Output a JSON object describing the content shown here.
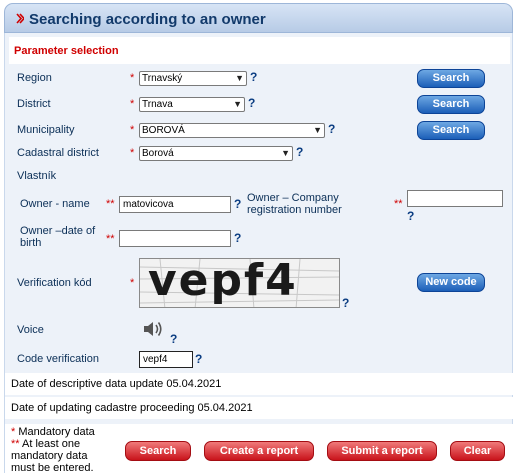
{
  "header": {
    "title": "Searching according to an owner"
  },
  "section": {
    "title": "Parameter selection"
  },
  "form": {
    "region": {
      "label": "Region",
      "marker": "*",
      "value": "Trnavský",
      "help": "?",
      "button": "Search"
    },
    "district": {
      "label": "District",
      "marker": "*",
      "value": "Trnava",
      "help": "?",
      "button": "Search"
    },
    "municipality": {
      "label": "Municipality",
      "marker": "*",
      "value": "BOROVÁ",
      "help": "?",
      "button": "Search"
    },
    "cadastral": {
      "label": "Cadastral district",
      "marker": "*",
      "value": "Borová",
      "help": "?"
    },
    "owner_heading": "Vlastník",
    "owner_name": {
      "label": "Owner - name",
      "marker": "**",
      "value": "matovicova",
      "help": "?"
    },
    "company_reg": {
      "label": "Owner – Company registration number",
      "marker": "**",
      "value": "",
      "help": "?"
    },
    "owner_birth": {
      "label": "Owner –date of birth",
      "marker": "**",
      "value": "",
      "help": "?"
    },
    "verification": {
      "label": "Verification kód",
      "marker": "*",
      "captcha_text": "vepf4",
      "help": "?",
      "new_code_button": "New code"
    },
    "voice": {
      "label": "Voice",
      "help": "?",
      "icon": "speaker-icon"
    },
    "code_verification": {
      "label": "Code verification",
      "value": "vepf4",
      "help": "?"
    }
  },
  "info": {
    "descriptive_update": "Date of descriptive data update 05.04.2021",
    "proceeding_update": "Date of updating cadastre proceeding 05.04.2021"
  },
  "footer": {
    "mandatory_marker": "*",
    "mandatory_text": "Mandatory data",
    "one_of_marker": "**",
    "one_of_text": "At least one mandatory data must be entered.",
    "buttons": {
      "search": "Search",
      "create_report": "Create a report",
      "submit_report": "Submit a report",
      "clear": "Clear"
    }
  },
  "colors": {
    "accent_blue": "#1c5fb8",
    "accent_red": "#c9131b",
    "panel": "#edf2f9",
    "required": "#d00000"
  }
}
